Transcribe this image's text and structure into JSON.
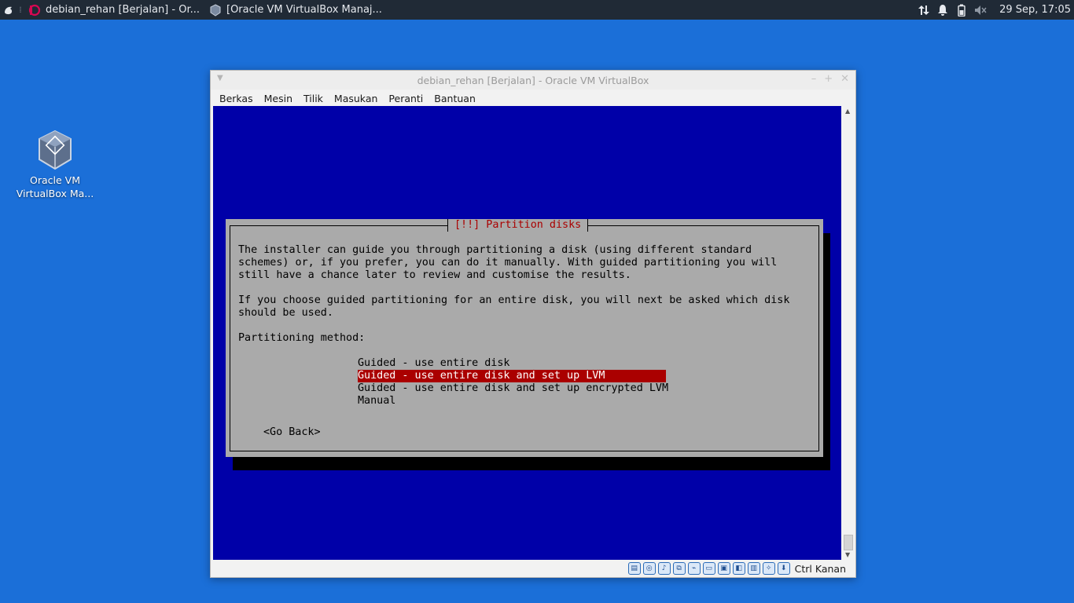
{
  "panel": {
    "task1": "debian_rehan [Berjalan] - Or...",
    "task2": "[Oracle VM VirtualBox Manaj...",
    "clock": "29 Sep, 17:05"
  },
  "desktop_icon": {
    "line1": "Oracle VM",
    "line2": "VirtualBox Ma..."
  },
  "window": {
    "title": "debian_rehan [Berjalan] - Oracle VM VirtualBox",
    "menu": [
      "Berkas",
      "Mesin",
      "Tilik",
      "Masukan",
      "Peranti",
      "Bantuan"
    ],
    "host_key": "Ctrl Kanan"
  },
  "installer": {
    "title": "[!!] Partition disks",
    "para1": [
      "The installer can guide you through partitioning a disk (using different standard",
      "schemes) or, if you prefer, you can do it manually. With guided partitioning you will",
      "still have a chance later to review and customise the results."
    ],
    "para2": [
      "If you choose guided partitioning for an entire disk, you will next be asked which disk",
      "should be used."
    ],
    "method_label": "Partitioning method:",
    "options": [
      "Guided - use entire disk",
      "Guided - use entire disk and set up LVM",
      "Guided - use entire disk and set up encrypted LVM",
      "Manual"
    ],
    "selected_index": 1,
    "go_back": "<Go Back>"
  },
  "colors": {
    "desktop": "#1b6fd8",
    "guest_bg": "#0000a8",
    "dialog_bg": "#aaaaaa",
    "selection": "#aa0000"
  }
}
